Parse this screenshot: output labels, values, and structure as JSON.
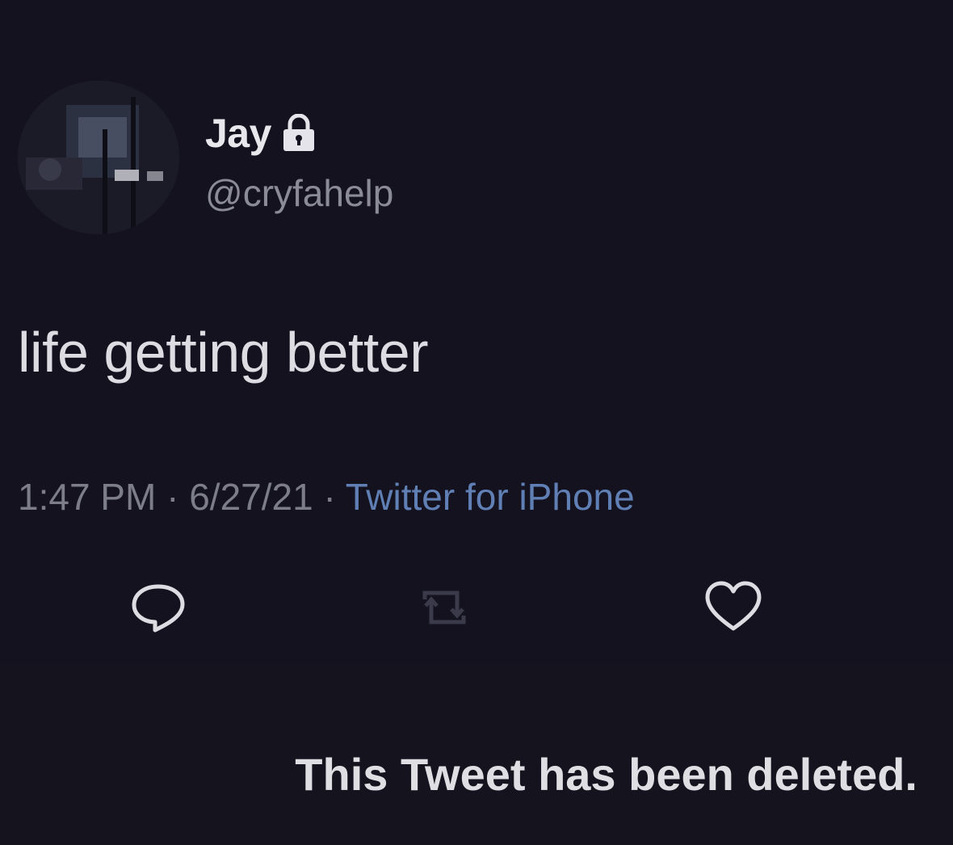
{
  "author": {
    "display_name": "Jay",
    "handle": "@cryfahelp",
    "protected_icon": "lock-icon",
    "avatar_icon": "avatar-image"
  },
  "tweet": {
    "text": "life getting better",
    "time": "1:47 PM",
    "date": "6/27/21",
    "separator": "·",
    "source": "Twitter for iPhone"
  },
  "actions": {
    "reply_icon": "reply-icon",
    "retweet_icon": "retweet-icon",
    "like_icon": "heart-icon"
  },
  "notice": {
    "deleted_message": "This Tweet has been deleted."
  },
  "colors": {
    "background": "#151320",
    "source_link": "#5f7fb5",
    "muted_text": "#7c7d88"
  }
}
